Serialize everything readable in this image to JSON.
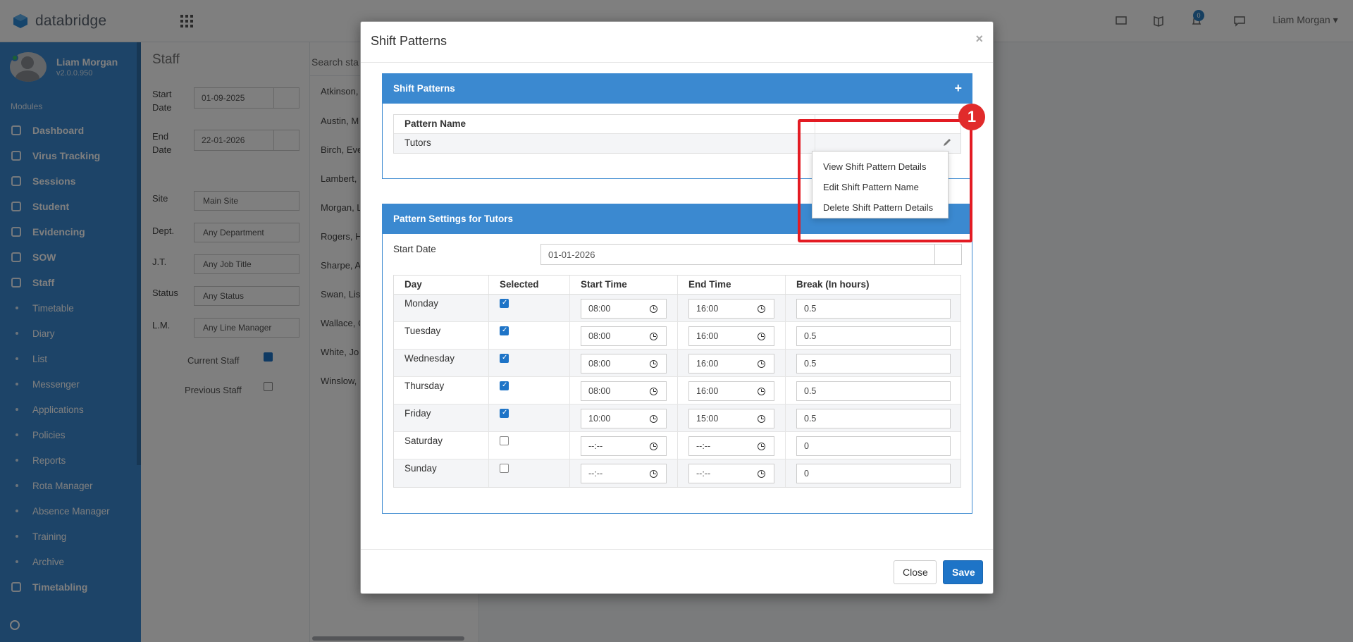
{
  "brand": {
    "name": "databridge",
    "logo_color": "#2d8ad8"
  },
  "topbar": {
    "notification_count": "0",
    "user_name": "Liam Morgan",
    "user_caret": "▾"
  },
  "sidebar": {
    "profile_name": "Liam Morgan",
    "version": "v2.0.0.950",
    "modules_label": "Modules",
    "main_items": [
      "Dashboard",
      "Virus Tracking",
      "Sessions",
      "Student",
      "Evidencing",
      "SOW",
      "Staff"
    ],
    "sub_items": [
      "Timetable",
      "Diary",
      "List",
      "Messenger",
      "Applications",
      "Policies",
      "Reports",
      "Rota Manager",
      "Absence Manager",
      "Training",
      "Archive"
    ],
    "last_item": "Timetabling",
    "color": "#3b89d0"
  },
  "staff_panel": {
    "title": "Staff",
    "start_date_label": "Start Date",
    "start_date": "01-09-2025",
    "end_date_label": "End Date",
    "end_date": "22-01-2026",
    "site_label": "Site",
    "site_value": "Main Site",
    "dept_label": "Dept.",
    "dept_value": "Any Department",
    "jt_label": "J.T.",
    "jt_value": "Any Job Title",
    "status_label": "Status",
    "status_value": "Any Status",
    "lm_label": "L.M.",
    "lm_value": "Any Line Manager",
    "current_staff_label": "Current Staff",
    "previous_staff_label": "Previous Staff"
  },
  "staff_list": {
    "search_placeholder": "Search sta",
    "names": [
      "Atkinson,",
      "Austin, M",
      "Birch, Eve",
      "Lambert,",
      "Morgan, L",
      "Rogers, H",
      "Sharpe, A",
      "Swan, Lis",
      "Wallace, C",
      "White, Jo",
      "Winslow,"
    ]
  },
  "modal": {
    "title": "Shift Patterns",
    "close_x": "×",
    "patterns_panel": {
      "heading": "Shift Patterns",
      "add_icon": "+",
      "column_header": "Pattern Name",
      "rows": [
        "Tutors"
      ]
    },
    "dropdown": {
      "items": [
        "View Shift Pattern Details",
        "Edit Shift Pattern Name",
        "Delete Shift Pattern Details"
      ]
    },
    "step_badge": "1",
    "settings_panel": {
      "heading": "Pattern Settings for Tutors",
      "start_date_label": "Start Date",
      "start_date": "01-01-2026",
      "columns": [
        "Day",
        "Selected",
        "Start Time",
        "End Time",
        "Break (In hours)"
      ],
      "rows": [
        {
          "day": "Monday",
          "selected": true,
          "start": "08:00",
          "end": "16:00",
          "break": "0.5"
        },
        {
          "day": "Tuesday",
          "selected": true,
          "start": "08:00",
          "end": "16:00",
          "break": "0.5"
        },
        {
          "day": "Wednesday",
          "selected": true,
          "start": "08:00",
          "end": "16:00",
          "break": "0.5"
        },
        {
          "day": "Thursday",
          "selected": true,
          "start": "08:00",
          "end": "16:00",
          "break": "0.5"
        },
        {
          "day": "Friday",
          "selected": true,
          "start": "10:00",
          "end": "15:00",
          "break": "0.5"
        },
        {
          "day": "Saturday",
          "selected": false,
          "start": "--:--",
          "end": "--:--",
          "break": "0"
        },
        {
          "day": "Sunday",
          "selected": false,
          "start": "--:--",
          "end": "--:--",
          "break": "0"
        }
      ]
    },
    "footer": {
      "close_label": "Close",
      "save_label": "Save"
    }
  },
  "colors": {
    "primary": "#1e74c7",
    "highlight": "#e31b23"
  }
}
